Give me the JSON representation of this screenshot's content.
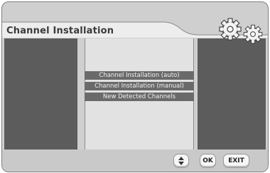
{
  "header": {
    "title": "Channel Installation",
    "icon": "gears-icon"
  },
  "menu": {
    "items": [
      {
        "label": "Channel Installation (auto)"
      },
      {
        "label": "Channel Installation (manual)"
      },
      {
        "label": "New Detected Channels"
      }
    ]
  },
  "footer": {
    "navigate_icon": "up-down-arrows-icon",
    "ok_label": "OK",
    "exit_label": "EXIT"
  },
  "colors": {
    "panel_dark": "#5c5c5c",
    "panel_light": "#e2e2e2",
    "menu_item_bg": "#6a6a6a",
    "frame_bg": "#cfcfcf"
  }
}
